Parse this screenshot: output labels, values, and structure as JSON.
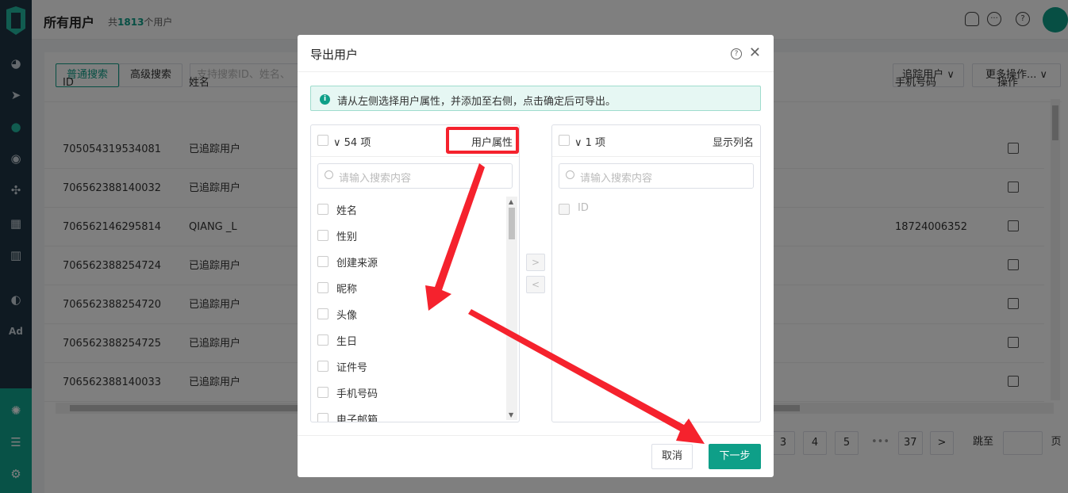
{
  "header": {
    "title": "所有用户",
    "count_prefix": "共",
    "count_value": "1813",
    "count_suffix": "个用户",
    "icons": [
      "bell-icon",
      "chat-icon",
      "help-icon"
    ]
  },
  "sidebar": {
    "icons": [
      "dashboard-icon",
      "send-icon",
      "user-icon",
      "users-icon",
      "group-icon",
      "grid-icon",
      "chart-icon",
      "wechat-icon",
      "ad-icon",
      "network-icon",
      "server-icon",
      "settings-icon"
    ],
    "ad_label": "Ad"
  },
  "toolbar": {
    "normal_search": "普通搜索",
    "advanced_search": "高级搜索",
    "search_placeholder": "支持搜索ID、姓名、",
    "track_user": "追踪用户",
    "more_ops": "更多操作..."
  },
  "table": {
    "headers": {
      "id": "ID",
      "name": "姓名",
      "phone": "手机号码",
      "ops": "操作"
    },
    "rows": [
      {
        "id": "705054319534081",
        "name": "已追踪用户",
        "phone": ""
      },
      {
        "id": "706562388140032",
        "name": "已追踪用户",
        "phone": ""
      },
      {
        "id": "706562146295814",
        "name": "QIANG _L",
        "phone": "18724006352"
      },
      {
        "id": "706562388254724",
        "name": "已追踪用户",
        "phone": ""
      },
      {
        "id": "706562388254720",
        "name": "已追踪用户",
        "phone": ""
      },
      {
        "id": "706562388254725",
        "name": "已追踪用户",
        "phone": ""
      },
      {
        "id": "706562388140033",
        "name": "已追踪用户",
        "phone": ""
      }
    ]
  },
  "pagination": {
    "pages": [
      "3",
      "4",
      "5"
    ],
    "ellipsis": "•••",
    "last": "37",
    "next": ">",
    "jump_label": "跳至",
    "page_suffix": "页"
  },
  "modal": {
    "title": "导出用户",
    "alert": "请从左侧选择用户属性，并添加至右侧，点击确定后可导出。",
    "left": {
      "count": "54 项",
      "title": "用户属性",
      "search_placeholder": "请输入搜索内容",
      "items": [
        "姓名",
        "性别",
        "创建来源",
        "昵称",
        "头像",
        "生日",
        "证件号",
        "手机号码",
        "电子邮箱"
      ]
    },
    "right": {
      "count": "1 项",
      "title": "显示列名",
      "search_placeholder": "请输入搜索内容",
      "items": [
        "ID"
      ]
    },
    "cancel": "取消",
    "next": "下一步"
  },
  "colors": {
    "accent": "#0e9f88",
    "annotation": "#f5222d",
    "sidebar": "#1f3545"
  }
}
